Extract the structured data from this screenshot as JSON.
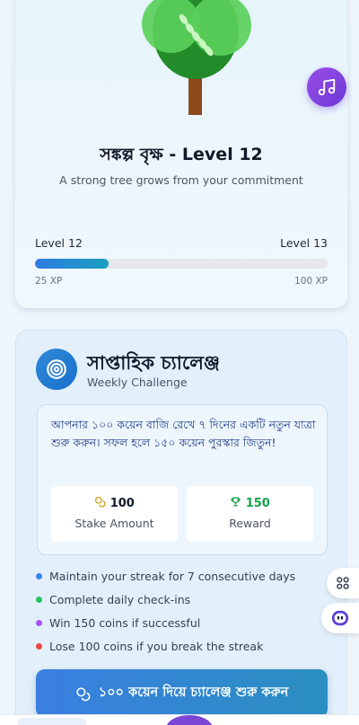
{
  "tree": {
    "title": "সঙ্কল্প বৃক্ষ - Level 12",
    "subtitle": "A strong tree grows from your commitment",
    "level_current": "Level 12",
    "level_next": "Level 13",
    "xp_current": "25 XP",
    "xp_max": "100 XP",
    "progress_percent": 25
  },
  "challenge": {
    "title": "সাপ্তাহিক চ্যালেঞ্জ",
    "subtitle": "Weekly Challenge",
    "description": "আপনার ১০০ কয়েন বাজি রেখে ৭ দিনের একটি নতুন যাত্রা শুরু করুন। সফল হলে ১৫০ কয়েন পুরস্কার জিতুন!",
    "stake_value": "100",
    "stake_label": "Stake Amount",
    "reward_value": "150",
    "reward_label": "Reward",
    "rules": [
      {
        "text": "Maintain your streak for 7 consecutive days",
        "color": "#3b82f6"
      },
      {
        "text": "Complete daily check-ins",
        "color": "#22c55e"
      },
      {
        "text": "Win 150 coins if successful",
        "color": "#a855f7"
      },
      {
        "text": "Lose 100 coins if you break the streak",
        "color": "#ef4444"
      }
    ],
    "cta_label": "১০০ কয়েন দিয়ে চ্যালেঞ্জ শুরু করুন"
  },
  "colors": {
    "primary": "#2f7be0",
    "reward_green": "#16a34a",
    "stake_gold": "#d4a017",
    "accent_purple": "#7c3aed"
  },
  "icons": {
    "music": "music-note-icon",
    "target": "target-icon",
    "coin": "coin-icon",
    "trophy": "trophy-icon",
    "grid": "grid-icon",
    "bot": "bot-icon"
  }
}
